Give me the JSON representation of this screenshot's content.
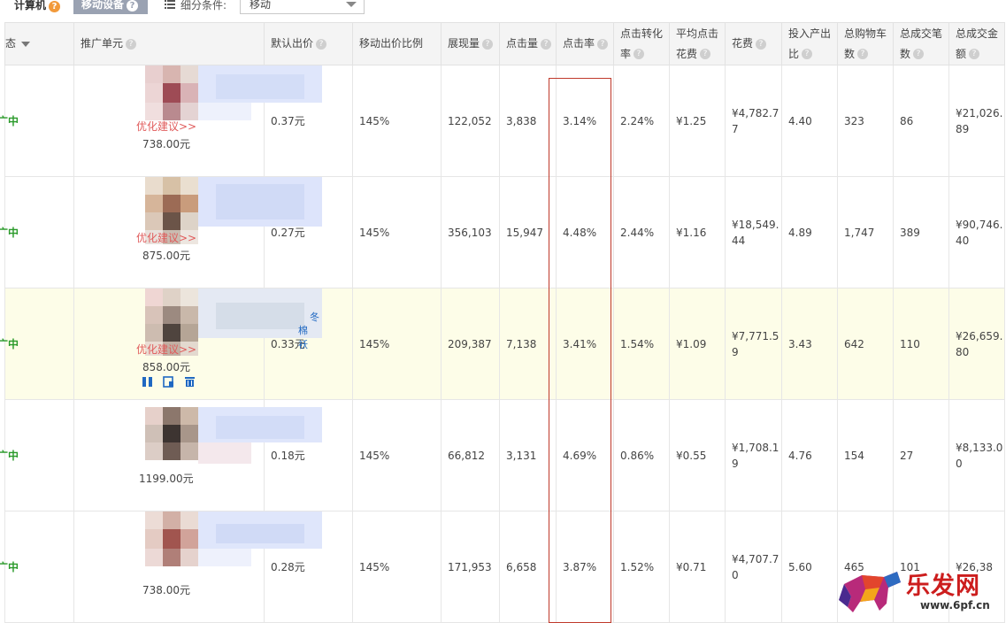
{
  "device_tabs": {
    "pc": "计算机",
    "mobile": "移动设备",
    "help": "?"
  },
  "filter": {
    "label": "细分条件:",
    "selected": "移动"
  },
  "table": {
    "columns": [
      {
        "key": "status",
        "label": "态"
      },
      {
        "key": "unit",
        "label": "推广单元"
      },
      {
        "key": "default_bid",
        "label": "默认出价"
      },
      {
        "key": "mobile_ratio",
        "label": "移动出价比例"
      },
      {
        "key": "impressions",
        "label": "展现量"
      },
      {
        "key": "clicks",
        "label": "点击量"
      },
      {
        "key": "ctr",
        "label": "点击率"
      },
      {
        "key": "cvr",
        "label": "点击转化率"
      },
      {
        "key": "cpc",
        "label": "平均点击花费"
      },
      {
        "key": "cost",
        "label": "花费"
      },
      {
        "key": "roi",
        "label": "投入产出比"
      },
      {
        "key": "cart",
        "label": "总购物车数"
      },
      {
        "key": "orders",
        "label": "总成交笔数"
      },
      {
        "key": "gmv",
        "label": "总成交金额"
      }
    ],
    "rows": [
      {
        "status": "广中",
        "unit_link": "优化建议>>",
        "unit_price": "738.00元",
        "default_bid": "0.37元",
        "mobile_ratio": "145%",
        "impressions": "122,052",
        "clicks": "3,838",
        "ctr": "3.14%",
        "cvr": "2.24%",
        "cpc": "¥1.25",
        "cost": "¥4,782.77",
        "roi": "4.40",
        "cart": "323",
        "orders": "86",
        "gmv": "¥21,026.89"
      },
      {
        "status": "广中",
        "unit_link": "优化建议>>",
        "unit_price": "875.00元",
        "default_bid": "0.27元",
        "mobile_ratio": "145%",
        "impressions": "356,103",
        "clicks": "15,947",
        "ctr": "4.48%",
        "cvr": "2.44%",
        "cpc": "¥1.16",
        "cost": "¥18,549.44",
        "roi": "4.89",
        "cart": "1,747",
        "orders": "389",
        "gmv": "¥90,746.40"
      },
      {
        "status": "广中",
        "unit_link": "优化建议>>",
        "unit_extra_1": "冬",
        "unit_extra_2": "棉袄",
        "unit_price": "858.00元",
        "default_bid": "0.33元",
        "mobile_ratio": "145%",
        "impressions": "209,387",
        "clicks": "7,138",
        "ctr": "3.41%",
        "cvr": "1.54%",
        "cpc": "¥1.09",
        "cost": "¥7,771.59",
        "roi": "3.43",
        "cart": "642",
        "orders": "110",
        "gmv": "¥26,659.80"
      },
      {
        "status": "广中",
        "unit_price": "1199.00元",
        "default_bid": "0.18元",
        "mobile_ratio": "145%",
        "impressions": "66,812",
        "clicks": "3,131",
        "ctr": "4.69%",
        "cvr": "0.86%",
        "cpc": "¥0.55",
        "cost": "¥1,708.19",
        "roi": "4.76",
        "cart": "154",
        "orders": "27",
        "gmv": "¥8,133.00"
      },
      {
        "status": "广中",
        "unit_price": "738.00元",
        "default_bid": "0.28元",
        "mobile_ratio": "145%",
        "impressions": "171,953",
        "clicks": "6,658",
        "ctr": "3.87%",
        "cvr": "1.52%",
        "cpc": "¥0.71",
        "cost": "¥4,707.70",
        "roi": "5.60",
        "cart": "465",
        "orders": "101",
        "gmv": "¥26,38"
      }
    ]
  },
  "icons": {
    "pause": "pause-icon",
    "edit": "edit-icon",
    "delete": "trash-icon",
    "filter": "list-filter-icon",
    "help": "help-circle-icon"
  },
  "colors": {
    "status_green": "#2a9a2a",
    "link_red": "#e05a5a",
    "highlight_row": "#fdfde8",
    "highlight_border": "#c0392b",
    "action_blue": "#1f68c2"
  },
  "watermark": {
    "site": "乐发网",
    "url": "www.6pf.cn"
  }
}
